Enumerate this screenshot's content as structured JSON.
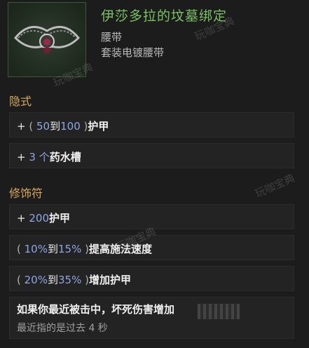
{
  "item": {
    "name": "伊莎多拉的坟墓绑定",
    "type": "腰带",
    "subtype": "套装电镀腰带"
  },
  "sections": {
    "implicit_label": "隐式",
    "affix_label": "修饰符"
  },
  "implicit": [
    {
      "plus": "+",
      "open": "(",
      "min": "50",
      "to": "到",
      "max": "100",
      "close": ")",
      "stat": "护甲"
    },
    {
      "plus": "+",
      "value": "3",
      "unit": "个",
      "stat": "药水槽"
    }
  ],
  "affixes": [
    {
      "plus": "+",
      "value": "200",
      "stat": "护甲"
    },
    {
      "open": "(",
      "min": "10%",
      "to": "到",
      "max": "15%",
      "close": ")",
      "stat": "提高施法速度"
    },
    {
      "open": "(",
      "min": "20%",
      "to": "到",
      "max": "35%",
      "close": ")",
      "stat": "增加护甲"
    },
    {
      "text": "如果你最近被击中，坏死伤害增加",
      "subtext": "最近指的是过去 4 秒"
    }
  ],
  "watermark": "玩咖宝典",
  "colors": {
    "item_name": "#7ac163",
    "section_label": "#d8a860",
    "value": "#8ea6e4"
  }
}
